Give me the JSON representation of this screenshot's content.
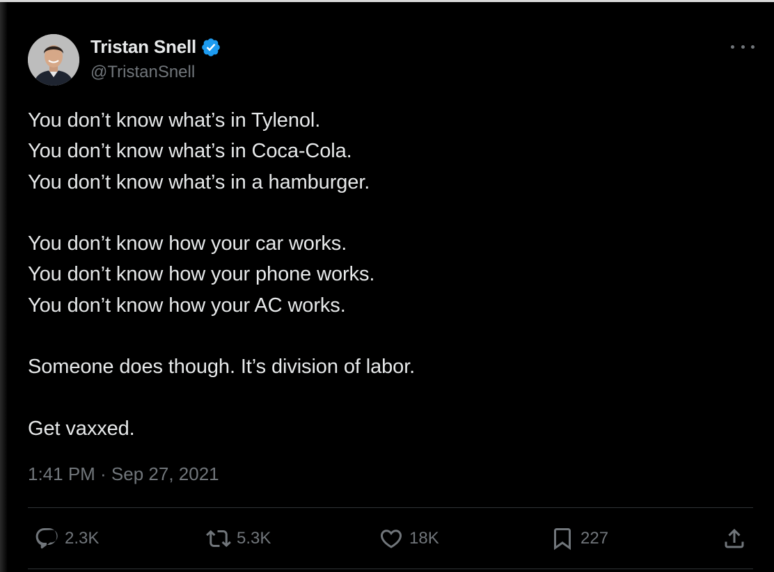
{
  "author": {
    "display_name": "Tristan Snell",
    "handle": "@TristanSnell",
    "verified": true,
    "verified_color": "#1d9bf0"
  },
  "tweet": {
    "lines": [
      "You don’t know what’s in Tylenol.",
      "You don’t know what’s in Coca-Cola.",
      "You don’t know what’s in a hamburger.",
      "",
      "You don’t know how your car works.",
      "You don’t know how your phone works.",
      "You don’t know how your AC works.",
      "",
      "Someone does though. It’s division of labor.",
      "",
      "Get vaxxed."
    ],
    "timestamp": "1:41 PM · Sep 27, 2021"
  },
  "actions": {
    "replies": "2.3K",
    "reposts": "5.3K",
    "likes": "18K",
    "bookmarks": "227"
  },
  "icons": {
    "more": "more-icon",
    "reply": "reply-icon",
    "repost": "repost-icon",
    "like": "heart-icon",
    "bookmark": "bookmark-icon",
    "share": "share-icon",
    "verified": "verified-badge-icon"
  },
  "colors": {
    "background": "#000000",
    "primary_text": "#e7e9ea",
    "secondary_text": "#71767b",
    "divider": "#2f3336"
  }
}
